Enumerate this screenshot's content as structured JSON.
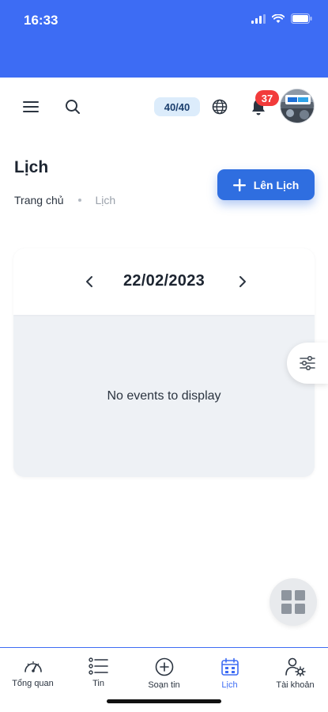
{
  "status": {
    "time": "16:33",
    "icons": [
      "signal-icon",
      "wifi-icon",
      "battery-icon"
    ]
  },
  "topbar": {
    "menu_icon": "menu-icon",
    "search_icon": "search-icon",
    "quota": "40/40",
    "language_icon": "globe-icon",
    "notification_icon": "bell-icon",
    "notification_count": "37",
    "avatar_icon": "avatar"
  },
  "header": {
    "title": "Lịch",
    "breadcrumb": [
      "Trang chủ",
      "Lịch"
    ],
    "schedule_button": "Lên Lịch"
  },
  "calendar": {
    "date": "22/02/2023",
    "empty_message": "No events to display"
  },
  "fabs": {
    "filter_icon": "sliders-icon",
    "apps_icon": "grid-icon"
  },
  "bottom_nav": [
    {
      "label": "Tổng quan",
      "icon": "dashboard-icon",
      "active": false
    },
    {
      "label": "Tin",
      "icon": "list-icon",
      "active": false
    },
    {
      "label": "Soạn tin",
      "icon": "plus-circle-icon",
      "active": false
    },
    {
      "label": "Lịch",
      "icon": "calendar-icon",
      "active": true
    },
    {
      "label": "Tài khoản",
      "icon": "account-icon",
      "active": false
    }
  ],
  "colors": {
    "brand": "#3d6cf4",
    "button": "#2f6ee0",
    "badge": "#f23b3b"
  }
}
